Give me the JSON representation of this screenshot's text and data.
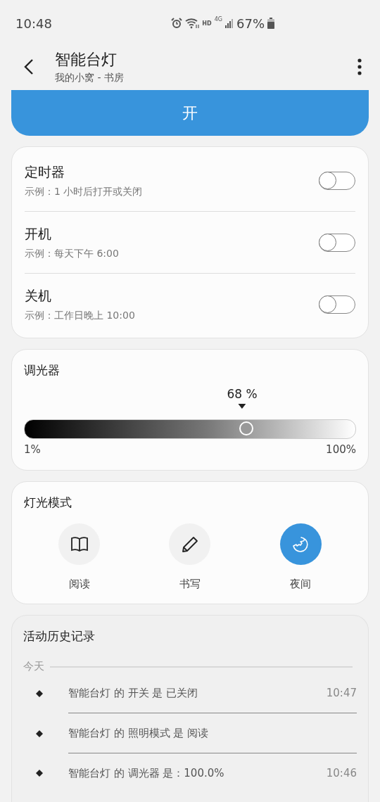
{
  "status_bar": {
    "time": "10:48",
    "network": "HD",
    "signal": "4G",
    "battery": "67%"
  },
  "header": {
    "title": "智能台灯",
    "subtitle": "我的小窝 - 书房"
  },
  "power_button": {
    "label": "开"
  },
  "schedules": [
    {
      "title": "定时器",
      "example": "示例：1 小时后打开或关闭",
      "on": false
    },
    {
      "title": "开机",
      "example": "示例：每天下午 6:00",
      "on": false
    },
    {
      "title": "关机",
      "example": "示例：工作日晚上 10:00",
      "on": false
    }
  ],
  "dimmer": {
    "title": "调光器",
    "reading": "68 %",
    "level": 0.67,
    "min_label": "1%",
    "max_label": "100%"
  },
  "light_mode": {
    "title": "灯光模式",
    "modes": [
      {
        "kind": "book",
        "label": "阅读",
        "selected": false
      },
      {
        "kind": "pencil",
        "label": "书写",
        "selected": false
      },
      {
        "kind": "moon",
        "label": "夜间",
        "selected": true
      }
    ]
  },
  "history": {
    "title": "活动历史记录",
    "day": "今天",
    "entries": [
      {
        "text": "智能台灯 的 开关 是 已关闭",
        "time": "10:47"
      },
      {
        "text": "智能台灯 的 照明模式 是 阅读"
      },
      {
        "text": "智能台灯 的 调光器 是：100.0%",
        "time": "10:46"
      }
    ]
  }
}
